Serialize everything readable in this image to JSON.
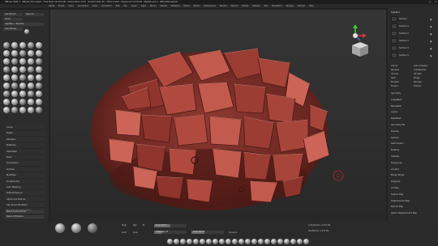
{
  "app": {
    "title": "ZBrush 2021.1 · ZBrush Document · Free Mem 19.176 GB · Active Mem 1713 · Scratch Disk 30 · Timer 0.003 · PolyCount 2.279 Mil · MeshCount 2 · ZBrushSculpt.zbr",
    "window_controls": [
      "–",
      "□",
      "×"
    ]
  },
  "menu": [
    "Alpha",
    "Brush",
    "Color",
    "Document",
    "Draw",
    "Dynamics",
    "Edit",
    "File",
    "Layer",
    "Light",
    "Macro",
    "Marker",
    "Material",
    "Movie",
    "Picker",
    "Preferences",
    "Render",
    "Stencil",
    "Stroke",
    "Texture",
    "Tool",
    "Transform",
    "Zplugin",
    "Zscript",
    "Help"
  ],
  "left_tray": {
    "top_buttons": [
      "Load Brush",
      "Save As",
      "Clone",
      "LightBox > Brushes",
      "Lazy Mouse"
    ],
    "list": [
      "Curve",
      "Depth",
      "Samples",
      "Elasticity",
      "FiberMesh",
      "Twist",
      "Orientation",
      "Surface",
      "Modifiers",
      "Sculptris Pro",
      "Auto Masking",
      "Tablet Pressure",
      "Alpha and Texture",
      "Clip Brush Modifiers",
      "Smooth Brush Modifiers",
      "Reset Brush Modifiers"
    ],
    "bottom_buttons": [
      "Reset Current Brush",
      "Reset All Brushes"
    ]
  },
  "right_panel": {
    "header": "SubTool",
    "subtools": [
      "Subtool",
      "Subtool 1",
      "Subtool 2",
      "Subtool 3",
      "Subtool 4",
      "Subtool 5"
    ],
    "buttons": [
      "List All",
      "Auto Collapse",
      "Rename",
      "AutoReorder",
      "All Low",
      "All High",
      "Split",
      "Merge",
      "Boolean",
      "Remesh",
      "Project",
      "Extract"
    ],
    "sections": [
      "Geometry",
      "ArrayMesh",
      "NanoMesh",
      "Layers",
      "FiberMesh",
      "Geometry HD",
      "Preview",
      "Surface",
      "Deformation",
      "Masking",
      "Visibility",
      "Polygroups",
      "Contact",
      "Morph Target",
      "Polypaint",
      "UV Map",
      "Texture Map",
      "Displacement Map",
      "Normal Map",
      "Vector Displacement Map"
    ]
  },
  "bottom_bar": {
    "mrgb": "Mrgb",
    "rgb": "Rgb",
    "m": "M",
    "zadd": "Zadd",
    "zsub": "Zsub",
    "focal_shift": "Focal Shift 0",
    "z_intensity": "Z Intensity 25",
    "draw_size": "Draw Size 64",
    "dynamic": "Dynamic",
    "active_points": "ActivePoints: 2.279 Mil",
    "total_points": "TotalPoints: 2.321 Mil",
    "focal_shift_value": 0.5,
    "z_intensity_value": 0.25,
    "draw_size_value": 0.4
  },
  "colors": {
    "clay": "#a24238",
    "clay_dark": "#5a1f1a",
    "clay_light": "#c9655a",
    "ui_bg": "#2a2a2a"
  },
  "icons": [
    "gizmo-icon",
    "navigation-cube-icon",
    "brush-cursor-icon"
  ]
}
